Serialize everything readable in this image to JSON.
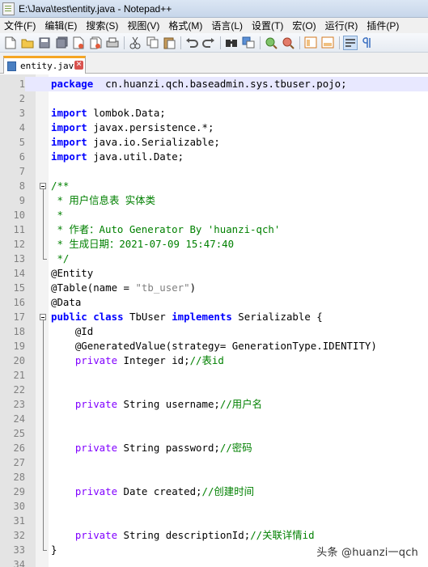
{
  "window": {
    "title": "E:\\Java\\test\\entity.java - Notepad++"
  },
  "menu": [
    "文件(F)",
    "编辑(E)",
    "搜索(S)",
    "视图(V)",
    "格式(M)",
    "语言(L)",
    "设置(T)",
    "宏(O)",
    "运行(R)",
    "插件(P)"
  ],
  "toolbar_icons": [
    "new-file-icon",
    "open-file-icon",
    "save-icon",
    "save-all-icon",
    "close-icon",
    "close-all-icon",
    "print-icon",
    "cut-icon",
    "copy-icon",
    "paste-icon",
    "undo-icon",
    "redo-icon",
    "find-icon",
    "replace-icon",
    "zoom-in-icon",
    "zoom-out-icon",
    "sync-v-icon",
    "sync-h-icon",
    "word-wrap-icon",
    "show-all-chars-icon"
  ],
  "tab": {
    "label": "entity.java"
  },
  "editor": {
    "current_line": 1,
    "lines": [
      [
        [
          "kw",
          "package"
        ],
        [
          "",
          "  cn.huanzi.qch.baseadmin.sys.tbuser.pojo;"
        ]
      ],
      [],
      [
        [
          "kw",
          "import"
        ],
        [
          "",
          " lombok.Data;"
        ]
      ],
      [
        [
          "kw",
          "import"
        ],
        [
          "",
          " javax.persistence.*;"
        ]
      ],
      [
        [
          "kw",
          "import"
        ],
        [
          "",
          " java.io.Serializable;"
        ]
      ],
      [
        [
          "kw",
          "import"
        ],
        [
          "",
          " java.util.Date;"
        ]
      ],
      [],
      [
        [
          "cm",
          "/**"
        ]
      ],
      [
        [
          "cm",
          " * 用户信息表 实体类"
        ]
      ],
      [
        [
          "cm",
          " *"
        ]
      ],
      [
        [
          "cm",
          " * 作者：Auto Generator By 'huanzi-qch'"
        ]
      ],
      [
        [
          "cm",
          " * 生成日期：2021-07-09 15:47:40"
        ]
      ],
      [
        [
          "cm",
          " */"
        ]
      ],
      [
        [
          "",
          "@Entity"
        ]
      ],
      [
        [
          "",
          "@Table(name = "
        ],
        [
          "st",
          "\"tb_user\""
        ],
        [
          "",
          ")"
        ]
      ],
      [
        [
          "",
          "@Data"
        ]
      ],
      [
        [
          "kw",
          "public"
        ],
        [
          "",
          ""
        ],
        [
          "kw",
          " class"
        ],
        [
          "",
          " TbUser "
        ],
        [
          "kw",
          "implements"
        ],
        [
          "",
          " Serializable {"
        ]
      ],
      [
        [
          "",
          "    @Id"
        ]
      ],
      [
        [
          "",
          "    @GeneratedValue(strategy= GenerationType.IDENTITY)"
        ]
      ],
      [
        [
          "ty",
          "    private"
        ],
        [
          "",
          " Integer id;"
        ],
        [
          "cm",
          "//表id"
        ]
      ],
      [],
      [],
      [
        [
          "ty",
          "    private"
        ],
        [
          "",
          " String username;"
        ],
        [
          "cm",
          "//用户名"
        ]
      ],
      [],
      [],
      [
        [
          "ty",
          "    private"
        ],
        [
          "",
          " String password;"
        ],
        [
          "cm",
          "//密码"
        ]
      ],
      [],
      [],
      [
        [
          "ty",
          "    private"
        ],
        [
          "",
          " Date created;"
        ],
        [
          "cm",
          "//创建时间"
        ]
      ],
      [],
      [],
      [
        [
          "ty",
          "    private"
        ],
        [
          "",
          " String descriptionId;"
        ],
        [
          "cm",
          "//关联详情id"
        ]
      ],
      [
        [
          "",
          "}"
        ]
      ],
      []
    ]
  },
  "watermark": "头条 @huanzi一qch"
}
